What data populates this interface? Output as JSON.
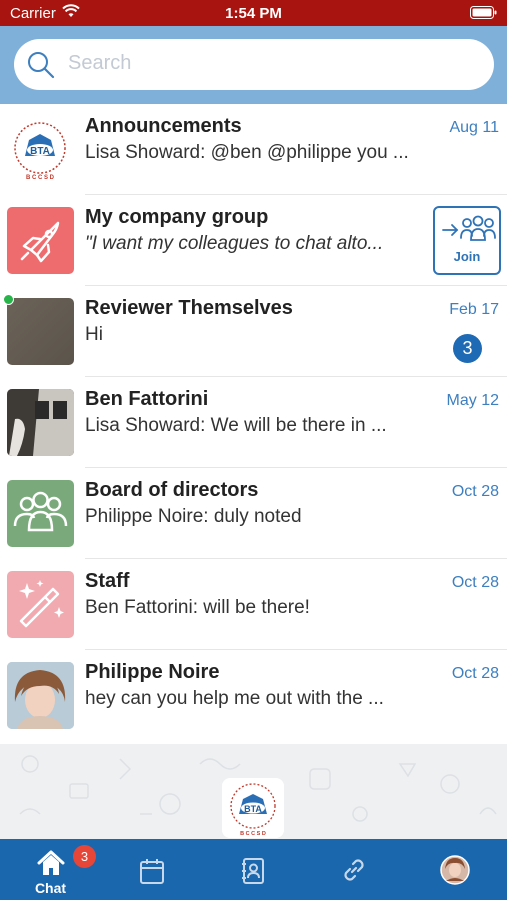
{
  "status_bar": {
    "carrier": "Carrier",
    "time": "1:54 PM"
  },
  "search": {
    "placeholder": "Search"
  },
  "colors": {
    "status_bar_bg": "#a8140f",
    "search_bar_bg": "#7fb0d9",
    "accent": "#1b67ad",
    "date_text": "#3d7fbf",
    "online": "#28b44a",
    "badge_red": "#e64638"
  },
  "chats": [
    {
      "name": "Announcements",
      "preview": "Lisa Showard: @ben @philippe you ...",
      "date": "Aug 11",
      "avatar": "bta-logo"
    },
    {
      "name": "My company group",
      "preview": "\"I want my colleagues to chat alto...",
      "date": "",
      "avatar": "rocket-icon",
      "join_label": "Join"
    },
    {
      "name": "Reviewer Themselves",
      "preview": "Hi",
      "date": "Feb 17",
      "avatar": "photo-grey",
      "unread": "3",
      "online": true
    },
    {
      "name": "Ben Fattorini",
      "preview": "Lisa Showard: We will be there in ...",
      "date": "May 12",
      "avatar": "photo-room"
    },
    {
      "name": "Board of directors",
      "preview": "Philippe Noire: duly noted",
      "date": "Oct 28",
      "avatar": "group-icon"
    },
    {
      "name": "Staff",
      "preview": "Ben Fattorini: will be there!",
      "date": "Oct 28",
      "avatar": "magic-wand-icon"
    },
    {
      "name": "Philippe Noire",
      "preview": "hey can you help me out with the ...",
      "date": "Oct 28",
      "avatar": "photo-person"
    }
  ],
  "tab_bar": {
    "tabs": [
      {
        "label": "Chat",
        "icon": "home-icon",
        "badge": "3",
        "active": true
      },
      {
        "label": "",
        "icon": "calendar-icon"
      },
      {
        "label": "",
        "icon": "contacts-icon"
      },
      {
        "label": "",
        "icon": "link-icon"
      },
      {
        "label": "",
        "icon": "profile-avatar"
      }
    ]
  }
}
